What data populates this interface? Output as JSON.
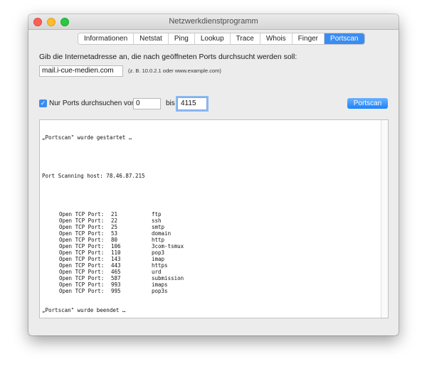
{
  "window": {
    "title": "Netzwerkdienstprogramm"
  },
  "tabs": [
    {
      "label": "Informationen"
    },
    {
      "label": "Netstat"
    },
    {
      "label": "Ping"
    },
    {
      "label": "Lookup"
    },
    {
      "label": "Trace"
    },
    {
      "label": "Whois"
    },
    {
      "label": "Finger"
    },
    {
      "label": "Portscan",
      "active": true
    }
  ],
  "form": {
    "prompt": "Gib die Internetadresse an, die nach geöffneten Ports durchsucht werden soll:",
    "host_value": "mail.i-cue-medien.com",
    "hint": "(z. B. 10.0.2.1 oder www.example.com)",
    "range_label": "Nur Ports durchsuchen von",
    "range_checked": true,
    "from_value": "0",
    "bis_label": "bis",
    "to_value": "4115",
    "scan_button": "Portscan"
  },
  "output": {
    "started": "„Portscan\" wurde gestartet …",
    "host_line": "Port Scanning host: 78.46.87.215",
    "port_prefix": "Open TCP Port:",
    "ports": [
      {
        "port": "21",
        "service": "ftp"
      },
      {
        "port": "22",
        "service": "ssh"
      },
      {
        "port": "25",
        "service": "smtp"
      },
      {
        "port": "53",
        "service": "domain"
      },
      {
        "port": "80",
        "service": "http"
      },
      {
        "port": "106",
        "service": "3com-tsmux"
      },
      {
        "port": "110",
        "service": "pop3"
      },
      {
        "port": "143",
        "service": "imap"
      },
      {
        "port": "443",
        "service": "https"
      },
      {
        "port": "465",
        "service": "urd"
      },
      {
        "port": "587",
        "service": "submission"
      },
      {
        "port": "993",
        "service": "imaps"
      },
      {
        "port": "995",
        "service": "pop3s"
      }
    ],
    "finished": "„Portscan\" wurde beendet …"
  },
  "colors": {
    "accent": "#3b8cf2",
    "window_bg": "#ececec"
  }
}
